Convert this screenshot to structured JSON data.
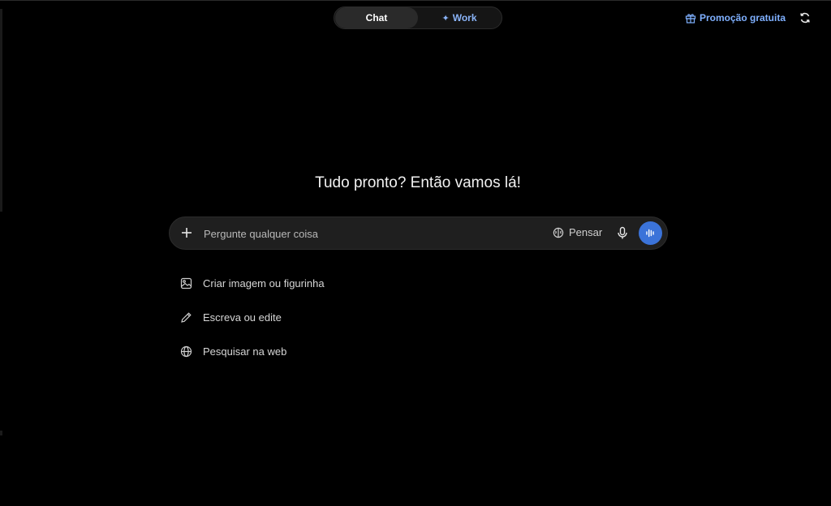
{
  "header": {
    "tabs": [
      {
        "label": "Chat",
        "active": true
      },
      {
        "label": "Work",
        "icon": "sparkle-icon",
        "active": false
      }
    ],
    "promo_label": "Promoção gratuita",
    "promo_icon": "gift-icon",
    "refresh_icon": "refresh-icon"
  },
  "main": {
    "title": "Tudo pronto? Então vamos lá!"
  },
  "composer": {
    "placeholder": "Pergunte qualquer coisa",
    "value": "",
    "think_label": "Pensar"
  },
  "suggestions": [
    {
      "label": "Criar imagem ou figurinha",
      "icon": "image-icon"
    },
    {
      "label": "Escreva ou edite",
      "icon": "pencil-icon"
    },
    {
      "label": "Pesquisar na web",
      "icon": "globe-icon"
    }
  ],
  "colors": {
    "background": "#000000",
    "accent": "#3b73d9",
    "link": "#7fb0ff"
  }
}
